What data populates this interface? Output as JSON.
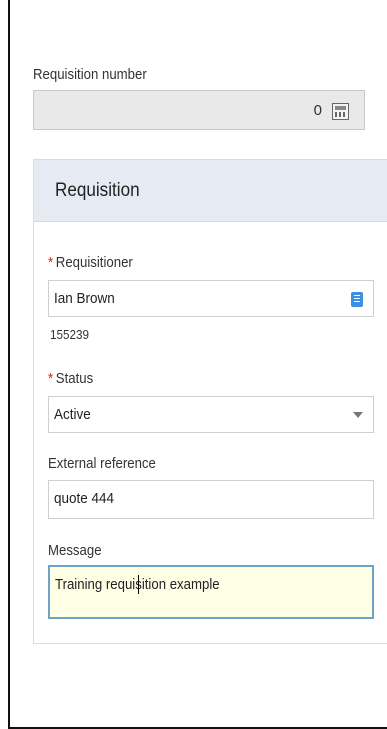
{
  "requisition_number": {
    "label": "Requisition number",
    "value": "0",
    "icon": "calculator-icon"
  },
  "panel": {
    "title": "Requisition"
  },
  "requisitioner": {
    "required_mark": "*",
    "label": "Requisitioner",
    "value": "Ian Brown",
    "id_number": "155239",
    "icon": "lookup-list-icon"
  },
  "status": {
    "required_mark": "*",
    "label": "Status",
    "value": "Active",
    "icon": "chevron-down-icon"
  },
  "external_reference": {
    "label": "External reference",
    "value": "quote 444"
  },
  "message": {
    "label": "Message",
    "value": "Training requisition example"
  },
  "colors": {
    "panel_header_bg": "#e6ebf3",
    "focused_border": "#6ca3c7",
    "focused_bg": "#ffffe6",
    "required": "#dd2222",
    "lookup_icon": "#3d8fe0"
  }
}
